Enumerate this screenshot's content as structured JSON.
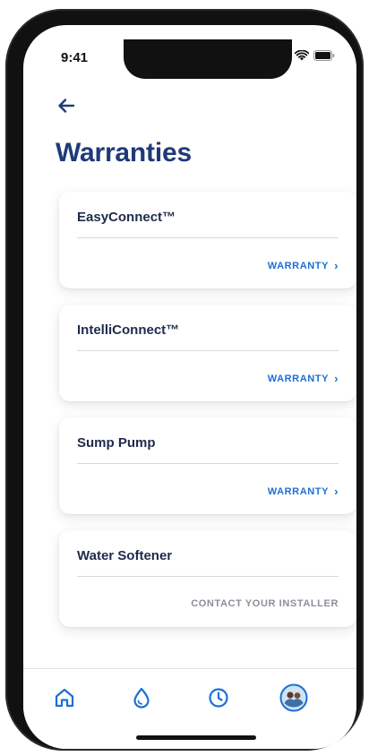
{
  "status_bar": {
    "time": "9:41"
  },
  "header": {
    "title": "Warranties"
  },
  "cards": [
    {
      "name": "EasyConnect™",
      "action": "WARRANTY",
      "has_chevron": true
    },
    {
      "name": "IntelliConnect™",
      "action": "WARRANTY",
      "has_chevron": true
    },
    {
      "name": "Sump Pump",
      "action": "WARRANTY",
      "has_chevron": true
    },
    {
      "name": "Water Softener",
      "action": "CONTACT YOUR INSTALLER",
      "has_chevron": false
    }
  ],
  "tabbar": {
    "items": [
      {
        "icon": "home-icon"
      },
      {
        "icon": "water-drop-icon"
      },
      {
        "icon": "clock-icon"
      },
      {
        "icon": "avatar"
      }
    ]
  },
  "colors": {
    "title": "#1e3a78",
    "link": "#1b6fd6",
    "muted": "#8a8f99",
    "tab_icon": "#1b6fd6"
  }
}
